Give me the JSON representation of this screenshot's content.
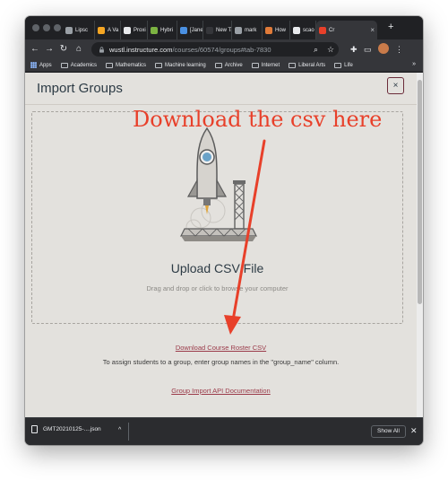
{
  "browser": {
    "tabs": [
      {
        "label": "Lipsc",
        "color": "#9aa0a6"
      },
      {
        "label": "A Va",
        "color": "#f5a623"
      },
      {
        "label": "Proxi",
        "color": "#e8eaed"
      },
      {
        "label": "Hybri",
        "color": "#7cb342"
      },
      {
        "label": "[Jane",
        "color": "#4a90e2"
      },
      {
        "label": "New Tab",
        "color": "#35363a"
      },
      {
        "label": "mark",
        "color": "#9aa0a6"
      },
      {
        "label": "How",
        "color": "#e07b39"
      },
      {
        "label": "scao",
        "color": "#e8eaed"
      },
      {
        "label": "Cr",
        "color": "#e8402a"
      }
    ],
    "url_host": "wustl.instructure.com",
    "url_path": "/courses/60574/groups#tab-7830",
    "bookmarks": [
      "Apps",
      "Academics",
      "Mathematics",
      "Machine learning",
      "Archive",
      "Internet",
      "Liberal Arts",
      "Life"
    ]
  },
  "modal": {
    "title": "Import Groups",
    "close_label": "×",
    "upload_title": "Upload CSV File",
    "upload_subtitle": "Drag and drop or click to browse your computer",
    "roster_link": "Download Course Roster CSV",
    "assign_note": "To assign students to a group, enter group names in the \"group_name\" column.",
    "api_link": "Group Import API Documentation"
  },
  "annotation": {
    "text": "Download the csv here",
    "color": "#e8402a"
  },
  "download_bar": {
    "filename": "GMT20210125-....json",
    "show_all": "Show All"
  }
}
